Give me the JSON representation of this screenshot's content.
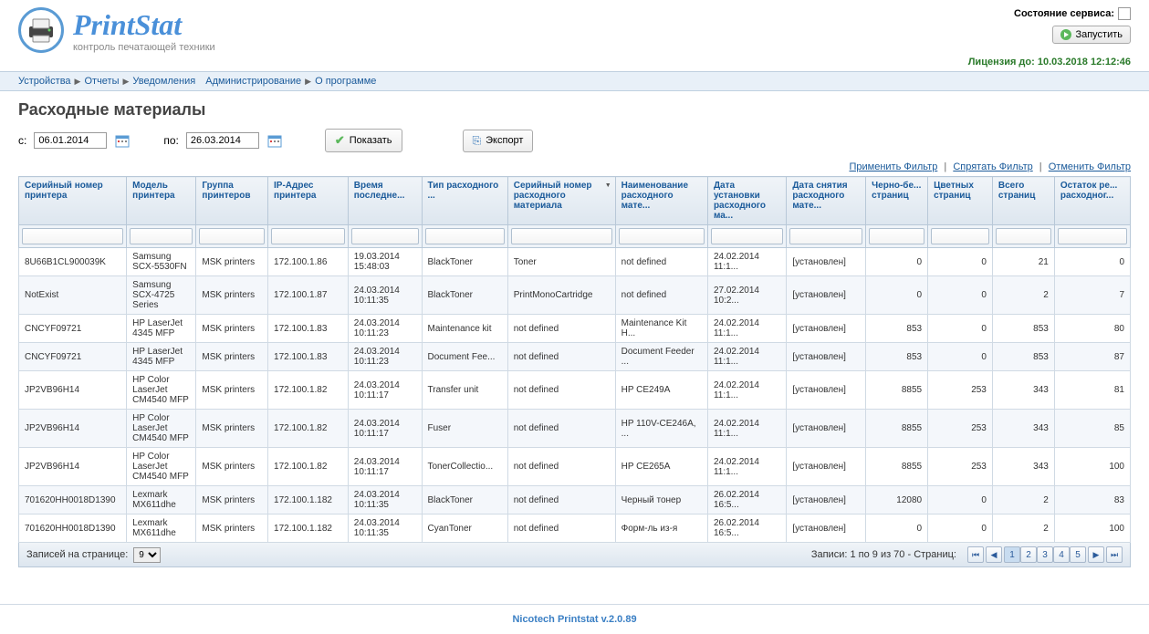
{
  "header": {
    "logo_title": "PrintStat",
    "logo_sub": "контроль печатающей техники",
    "service_status_label": "Состояние сервиса:",
    "run_label": "Запустить"
  },
  "license_text": "Лицензия до: 10.03.2018 12:12:46",
  "nav": {
    "devices": "Устройства",
    "reports": "Отчеты",
    "notifications": "Уведомления",
    "admin": "Администрирование",
    "about": "О программе"
  },
  "page": {
    "title": "Расходные материалы",
    "from_label": "с:",
    "to_label": "по:",
    "from_value": "06.01.2014",
    "to_value": "26.03.2014",
    "show_btn": "Показать",
    "export_btn": "Экспорт"
  },
  "filter_links": {
    "apply": "Применить Фильтр",
    "hide": "Спрятать Фильтр",
    "cancel": "Отменить Фильтр"
  },
  "columns": [
    "Серийный номер принтера",
    "Модель принтера",
    "Группа принтеров",
    "IP-Адрес принтера",
    "Время последне...",
    "Тип расходного ...",
    "Серийный номер расходного материала",
    "Наименование расходного мате...",
    "Дата установки расходного ма...",
    "Дата снятия расходного мате...",
    "Черно-бе... страниц",
    "Цветных страниц",
    "Всего страниц",
    "Остаток ре... расходног..."
  ],
  "rows": [
    {
      "c": [
        "8U66B1CL900039K",
        "Samsung SCX-5530FN",
        "MSK printers",
        "172.100.1.86",
        "19.03.2014 15:48:03",
        "BlackToner",
        "Toner",
        "not defined",
        "24.02.2014 11:1...",
        "[установлен]",
        "0",
        "0",
        "21",
        "0"
      ]
    },
    {
      "c": [
        "NotExist",
        "Samsung SCX-4725 Series",
        "MSK printers",
        "172.100.1.87",
        "24.03.2014 10:11:35",
        "BlackToner",
        "PrintMonoCartridge",
        "not defined",
        "27.02.2014 10:2...",
        "[установлен]",
        "0",
        "0",
        "2",
        "7"
      ]
    },
    {
      "c": [
        "CNCYF09721",
        "HP LaserJet 4345 MFP",
        "MSK printers",
        "172.100.1.83",
        "24.03.2014 10:11:23",
        "Maintenance kit",
        "not defined",
        "Maintenance Kit H...",
        "24.02.2014 11:1...",
        "[установлен]",
        "853",
        "0",
        "853",
        "80"
      ]
    },
    {
      "c": [
        "CNCYF09721",
        "HP LaserJet 4345 MFP",
        "MSK printers",
        "172.100.1.83",
        "24.03.2014 10:11:23",
        "Document Fee...",
        "not defined",
        "Document Feeder ...",
        "24.02.2014 11:1...",
        "[установлен]",
        "853",
        "0",
        "853",
        "87"
      ]
    },
    {
      "c": [
        "JP2VB96H14",
        "HP Color LaserJet CM4540 MFP",
        "MSK printers",
        "172.100.1.82",
        "24.03.2014 10:11:17",
        "Transfer unit",
        "not defined",
        "HP CE249A",
        "24.02.2014 11:1...",
        "[установлен]",
        "8855",
        "253",
        "343",
        "81"
      ]
    },
    {
      "c": [
        "JP2VB96H14",
        "HP Color LaserJet CM4540 MFP",
        "MSK printers",
        "172.100.1.82",
        "24.03.2014 10:11:17",
        "Fuser",
        "not defined",
        "HP 110V-CE246A, ...",
        "24.02.2014 11:1...",
        "[установлен]",
        "8855",
        "253",
        "343",
        "85"
      ]
    },
    {
      "c": [
        "JP2VB96H14",
        "HP Color LaserJet CM4540 MFP",
        "MSK printers",
        "172.100.1.82",
        "24.03.2014 10:11:17",
        "TonerCollectio...",
        "not defined",
        "HP CE265A",
        "24.02.2014 11:1...",
        "[установлен]",
        "8855",
        "253",
        "343",
        "100"
      ]
    },
    {
      "c": [
        "701620HH0018D1390",
        "Lexmark MX611dhe",
        "MSK printers",
        "172.100.1.182",
        "24.03.2014 10:11:35",
        "BlackToner",
        "not defined",
        "Черный тонер",
        "26.02.2014 16:5...",
        "[установлен]",
        "12080",
        "0",
        "2",
        "83"
      ]
    },
    {
      "c": [
        "701620HH0018D1390",
        "Lexmark MX611dhe",
        "MSK printers",
        "172.100.1.182",
        "24.03.2014 10:11:35",
        "CyanToner",
        "not defined",
        "Форм-ль из-я",
        "26.02.2014 16:5...",
        "[установлен]",
        "0",
        "0",
        "2",
        "100"
      ]
    }
  ],
  "footer": {
    "per_page_label": "Записей на странице:",
    "per_page_value": "9",
    "pager_info": "Записи: 1 по 9 из 70 - Страниц:",
    "pages": [
      "1",
      "2",
      "3",
      "4",
      "5"
    ]
  },
  "app_footer": "Nicotech Printstat v.2.0.89"
}
